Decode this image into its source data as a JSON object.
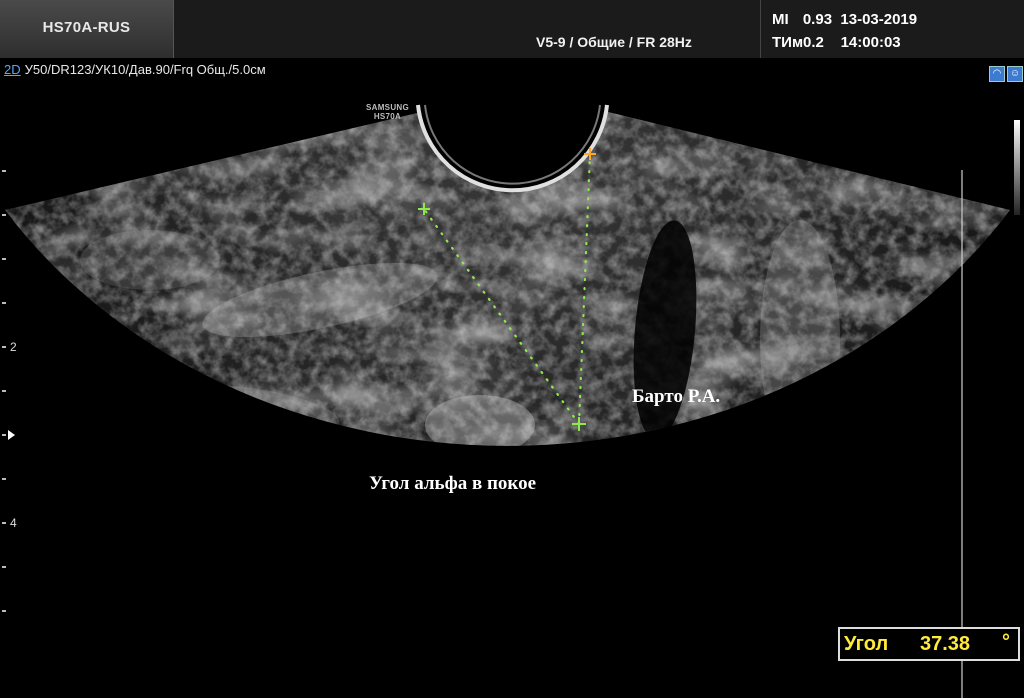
{
  "header": {
    "device": "HS70A-RUS",
    "probe_info": "V5-9 / Общие / FR 28Hz",
    "mi_label": "MI",
    "mi_value": "0.93",
    "date": "13-03-2019",
    "ti_label": "ТИм0.2",
    "time": "14:00:03"
  },
  "params": {
    "mode": "2D",
    "line": "У50/DR123/УК10/Дав.90/Frq Общ./5.0см"
  },
  "logo": {
    "line1": "SAMSUNG",
    "line2": "HS70A"
  },
  "depth_scale": {
    "labels": [
      "2",
      "4"
    ]
  },
  "annotations": {
    "name": "Барто Р.А.",
    "angle_caption": "Угол альфа в покое"
  },
  "measurement": {
    "label": "Угол",
    "value": "37.38",
    "unit": "°"
  },
  "colors": {
    "caliper_green": "#8eea4a",
    "caliper_orange": "#ffa726",
    "measure_yellow": "#ffeb3b",
    "mode_blue": "#58a6ff"
  },
  "icons": [
    "probe-icon",
    "body-mark-icon"
  ]
}
